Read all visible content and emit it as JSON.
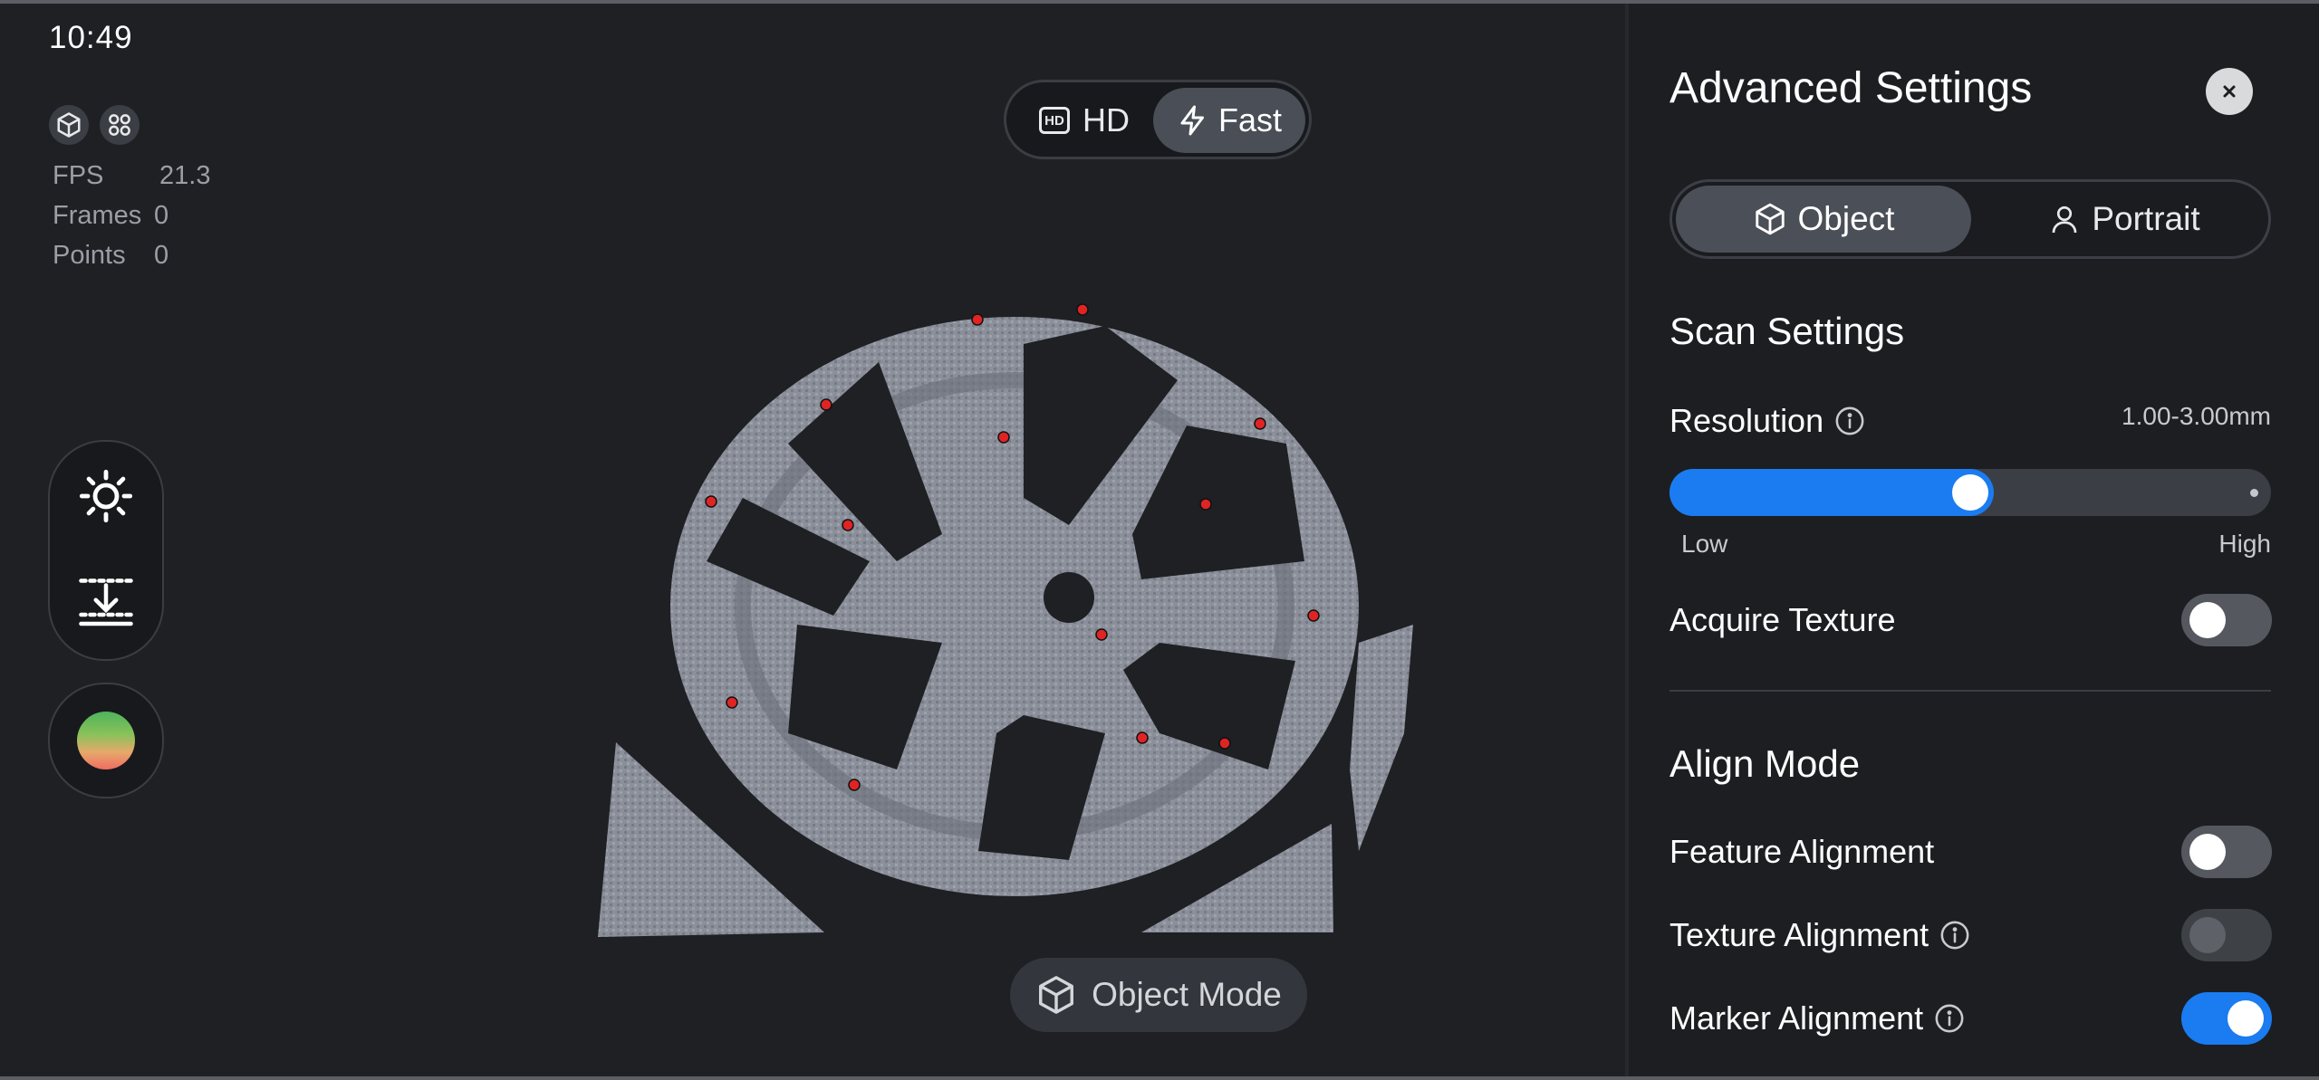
{
  "status": {
    "time": "10:49",
    "stats": [
      {
        "label": "FPS",
        "value": "21.3"
      },
      {
        "label": "Frames",
        "value": "0"
      },
      {
        "label": "Points",
        "value": "0"
      }
    ]
  },
  "quality_toggle": {
    "hd_label": "HD",
    "fast_label": "Fast",
    "selected": "Fast"
  },
  "hd_badge_text": "HD",
  "bottom_mode": {
    "label": "Object Mode"
  },
  "settings": {
    "title": "Advanced Settings",
    "mode_tabs": {
      "object": "Object",
      "portrait": "Portrait",
      "selected": "Object"
    },
    "scan_settings_title": "Scan Settings",
    "resolution": {
      "label": "Resolution",
      "range_text": "1.00-3.00mm",
      "low_label": "Low",
      "high_label": "High",
      "value_fraction": 0.5
    },
    "acquire_texture": {
      "label": "Acquire Texture",
      "on": false
    },
    "align_mode_title": "Align Mode",
    "feature_alignment": {
      "label": "Feature Alignment",
      "on": false
    },
    "texture_alignment": {
      "label": "Texture Alignment",
      "on": false,
      "disabled": true
    },
    "marker_alignment": {
      "label": "Marker Alignment",
      "on": true
    }
  },
  "colors": {
    "accent": "#1a7cf0",
    "marker": "#e02424",
    "scan_gray": "#8a8f9a"
  }
}
